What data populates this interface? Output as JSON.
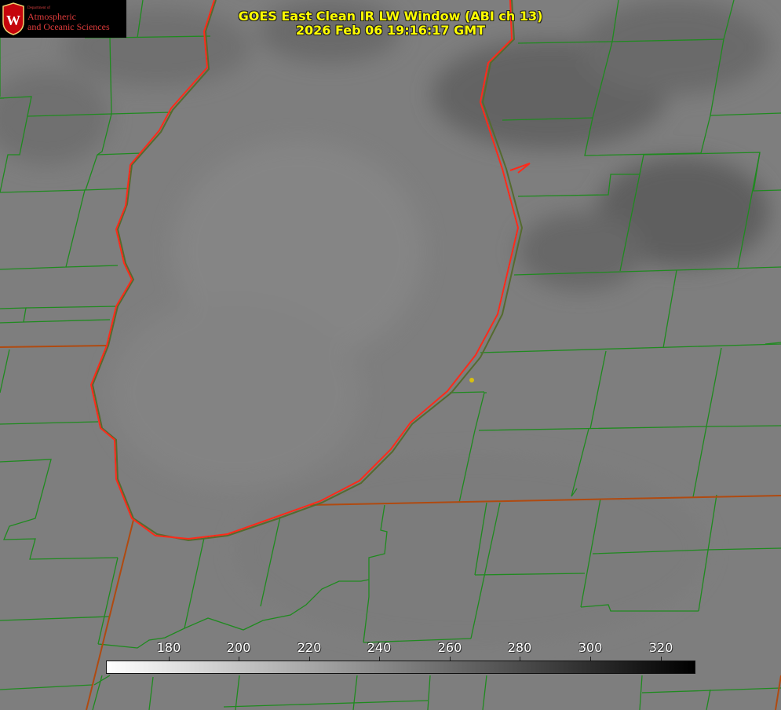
{
  "header": {
    "title_line1": "GOES East Clean IR LW Window (ABI ch 13)",
    "title_line2": "2026 Feb 06 19:16:17 GMT"
  },
  "logo": {
    "small_text": "Department of",
    "line1": "Atmospheric",
    "line2": "and Oceanic Sciences",
    "emblem": "uw-crest-icon",
    "emblem_letter": "W"
  },
  "colorbar": {
    "ticks": [
      "180",
      "200",
      "220",
      "240",
      "260",
      "280",
      "300",
      "320"
    ],
    "gradient": [
      "#ffffff",
      "#000000"
    ]
  },
  "colors": {
    "county_lines": "#1f8a1f",
    "shoreline": "#ff2a1a",
    "state_lines": "#b04a10",
    "marker": "#d8c010",
    "title": "#ffff00"
  }
}
